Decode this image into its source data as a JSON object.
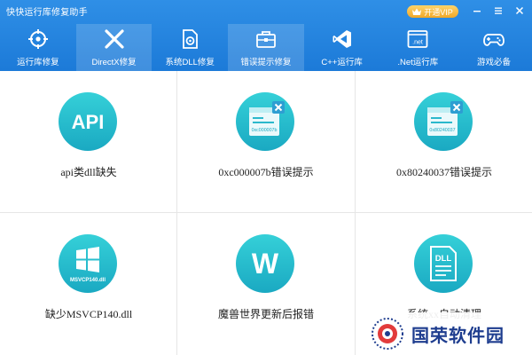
{
  "app": {
    "title": "快快运行库修复助手",
    "vip_label": "开通VIP"
  },
  "window_controls": [
    "minimize-icon",
    "menu-icon",
    "close-icon"
  ],
  "nav": {
    "items": [
      {
        "label": "运行库修复",
        "icon": "target-icon",
        "active": false
      },
      {
        "label": "DirectX修复",
        "icon": "directx-icon",
        "active": true
      },
      {
        "label": "系统DLL修复",
        "icon": "dll-gear-icon",
        "active": false
      },
      {
        "label": "错误提示修复",
        "icon": "toolbox-icon",
        "active": false
      },
      {
        "label": "C++运行库",
        "icon": "visual-studio-icon",
        "active": false
      },
      {
        "label": ".Net运行库",
        "icon": "dotnet-window-icon",
        "active": false
      },
      {
        "label": "游戏必备",
        "icon": "gamepad-icon",
        "active": false
      }
    ]
  },
  "cards": [
    {
      "label": "api类dll缺失",
      "icon": "api-icon",
      "icon_text": "API"
    },
    {
      "label": "0xc000007b错误提示",
      "icon": "error-window-icon",
      "icon_text": "0xc000007b"
    },
    {
      "label": "0x80240037错误提示",
      "icon": "error-window-icon",
      "icon_text": "0x80240037"
    },
    {
      "label": "缺少MSVCP140.dll",
      "icon": "windows-icon",
      "icon_text": "MSVCP140.dll"
    },
    {
      "label": "魔兽世界更新后报错",
      "icon": "w-letter-icon",
      "icon_text": "W"
    },
    {
      "label": "系统xx自动清理",
      "icon": "dll-document-icon",
      "icon_text": "DLL"
    }
  ],
  "watermark": {
    "text": "国荣软件园"
  },
  "colors": {
    "header_blue": "#1c7ad8",
    "icon_teal_top": "#35d0d8",
    "icon_teal_bottom": "#1aa9c2",
    "vip_gold": "#f0a728"
  }
}
